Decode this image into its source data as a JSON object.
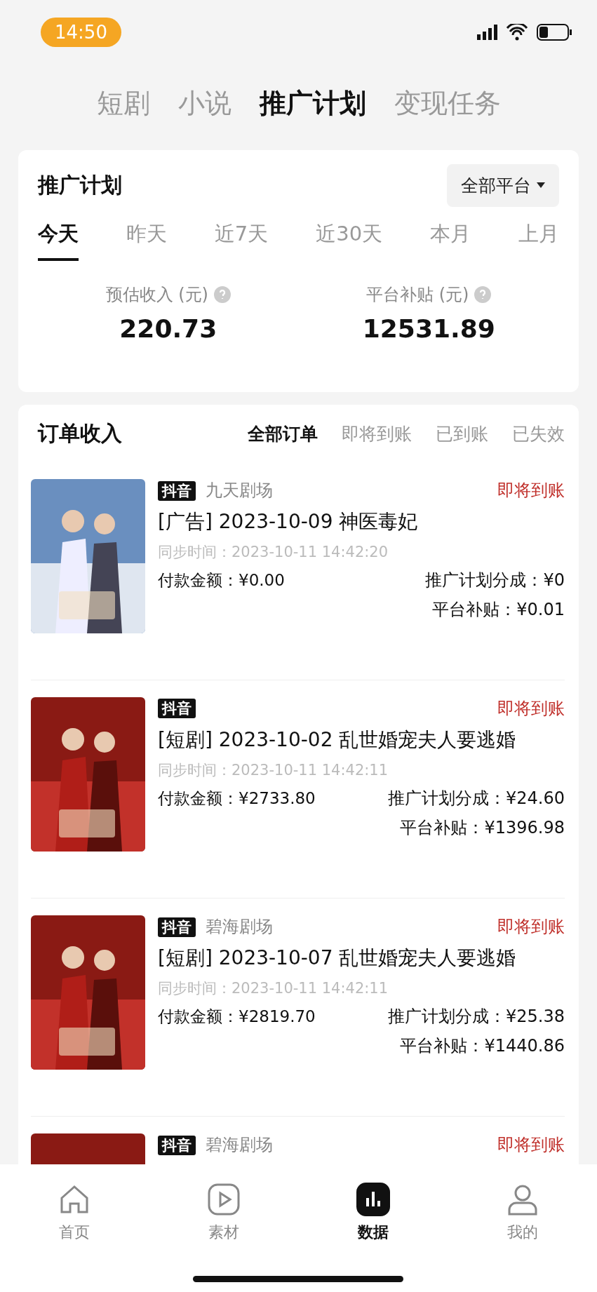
{
  "status_bar": {
    "time": "14:50"
  },
  "top_tabs": [
    {
      "label": "短剧",
      "selected": false
    },
    {
      "label": "小说",
      "selected": false
    },
    {
      "label": "推广计划",
      "selected": true
    },
    {
      "label": "变现任务",
      "selected": false
    }
  ],
  "summary": {
    "title": "推广计划",
    "platform_filter": "全部平台",
    "periods": [
      {
        "label": "今天",
        "selected": true
      },
      {
        "label": "昨天",
        "selected": false
      },
      {
        "label": "近7天",
        "selected": false
      },
      {
        "label": "近30天",
        "selected": false
      },
      {
        "label": "本月",
        "selected": false
      },
      {
        "label": "上月",
        "selected": false
      }
    ],
    "stats": [
      {
        "label": "预估收入 (元)",
        "value": "220.73"
      },
      {
        "label": "平台补贴 (元)",
        "value": "12531.89"
      }
    ]
  },
  "orders": {
    "title": "订单收入",
    "filters": [
      {
        "label": "全部订单",
        "selected": true
      },
      {
        "label": "即将到账",
        "selected": false
      },
      {
        "label": "已到账",
        "selected": false
      },
      {
        "label": "已失效",
        "selected": false
      }
    ],
    "items": [
      {
        "badge": "抖音",
        "source": "九天剧场",
        "status": "即将到账",
        "title": "[广告] 2023-10-09 神医毒妃",
        "sync": "同步时间：2023-10-11 14:42:20",
        "paid": "付款金额：¥0.00",
        "share": "推广计划分成：¥0",
        "subsidy": "平台补贴：¥0.01"
      },
      {
        "badge": "抖音",
        "status": "即将到账",
        "title": "[短剧] 2023-10-02 乱世婚宠夫人要逃婚",
        "sync": "同步时间：2023-10-11 14:42:11",
        "paid": "付款金额：¥2733.80",
        "share": "推广计划分成：¥24.60",
        "subsidy": "平台补贴：¥1396.98"
      },
      {
        "badge": "抖音",
        "source": "碧海剧场",
        "status": "即将到账",
        "title": "[短剧] 2023-10-07 乱世婚宠夫人要逃婚",
        "sync": "同步时间：2023-10-11 14:42:11",
        "paid": "付款金额：¥2819.70",
        "share": "推广计划分成：¥25.38",
        "subsidy": "平台补贴：¥1440.86"
      },
      {
        "badge": "抖音",
        "source": "碧海剧场",
        "status": "即将到账"
      }
    ]
  },
  "bottom_nav": [
    {
      "label": "首页",
      "selected": false
    },
    {
      "label": "素材",
      "selected": false
    },
    {
      "label": "数据",
      "selected": true
    },
    {
      "label": "我的",
      "selected": false
    }
  ]
}
